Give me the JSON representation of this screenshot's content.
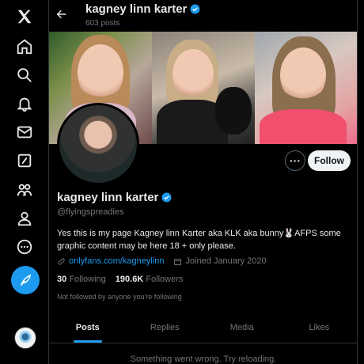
{
  "nav": {
    "items": [
      {
        "icon": "x-logo-icon"
      },
      {
        "icon": "home-icon"
      },
      {
        "icon": "search-icon"
      },
      {
        "icon": "bell-icon"
      },
      {
        "icon": "mail-icon"
      },
      {
        "icon": "grok-icon"
      },
      {
        "icon": "communities-icon"
      },
      {
        "icon": "profile-icon"
      },
      {
        "icon": "more-icon"
      }
    ],
    "compose_icon": "feather-icon"
  },
  "header": {
    "name": "kagney linn karter",
    "post_count": "603 posts"
  },
  "profile": {
    "name": "kagney linn karter",
    "handle": "@flyingspreadies",
    "bio": "Yes this is my page Kagney linn Karter aka KLK aka bunny🐰AFPS some graphic content may be here 18 + only please.",
    "link": "onlyfans.com/kagneylinn",
    "joined": "Joined January 2020",
    "following_count": "30",
    "following_label": "Following",
    "followers_count": "190.6K",
    "followers_label": "Followers",
    "mutuals": "Not followed by anyone you're following"
  },
  "actions": {
    "more": "···",
    "follow": "Follow"
  },
  "tabs": [
    {
      "label": "Posts"
    },
    {
      "label": "Replies"
    },
    {
      "label": "Media"
    },
    {
      "label": "Likes"
    }
  ],
  "error_text": "Something went wrong. Try reloading.",
  "colors": {
    "accent": "#1d9bf0",
    "background": "#000000",
    "muted": "#71767b"
  }
}
